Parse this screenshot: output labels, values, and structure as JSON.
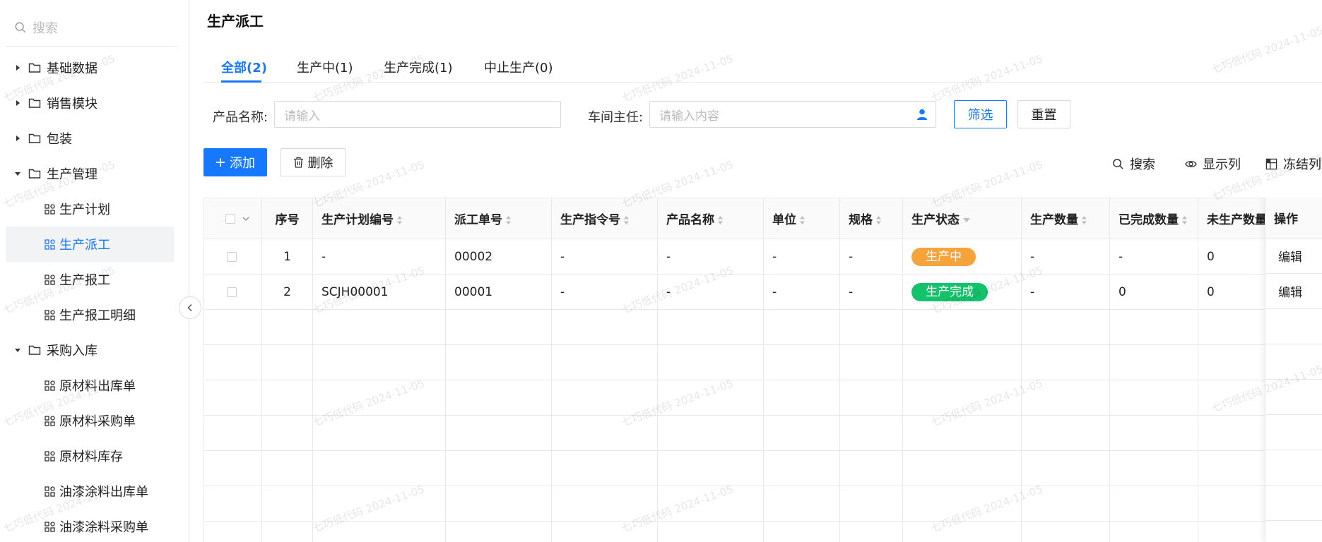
{
  "sidebar": {
    "search_placeholder": "搜索",
    "items": [
      {
        "label": "基础数据",
        "type": "folder",
        "expanded": false
      },
      {
        "label": "销售模块",
        "type": "folder",
        "expanded": false
      },
      {
        "label": "包装",
        "type": "folder",
        "expanded": false
      },
      {
        "label": "生产管理",
        "type": "folder",
        "expanded": true
      },
      {
        "label": "生产计划",
        "type": "page"
      },
      {
        "label": "生产派工",
        "type": "page",
        "active": true
      },
      {
        "label": "生产报工",
        "type": "page"
      },
      {
        "label": "生产报工明细",
        "type": "page"
      },
      {
        "label": "采购入库",
        "type": "folder",
        "expanded": true
      },
      {
        "label": "原材料出库单",
        "type": "page"
      },
      {
        "label": "原材料采购单",
        "type": "page"
      },
      {
        "label": "原材料库存",
        "type": "page"
      },
      {
        "label": "油漆涂料出库单",
        "type": "page"
      },
      {
        "label": "油漆涂料采购单",
        "type": "page"
      }
    ]
  },
  "page": {
    "title": "生产派工",
    "tabs": [
      {
        "label": "全部(2)",
        "active": true
      },
      {
        "label": "生产中(1)"
      },
      {
        "label": "生产完成(1)"
      },
      {
        "label": "中止生产(0)"
      }
    ]
  },
  "filters": {
    "product_label": "产品名称:",
    "product_placeholder": "请输入",
    "director_label": "车间主任:",
    "director_placeholder": "请输入内容",
    "filter_button": "筛选",
    "reset_button": "重置"
  },
  "toolbar": {
    "add_button": "添加",
    "delete_button": "删除",
    "search": "搜索",
    "show_columns": "显示列",
    "freeze_columns": "冻结列"
  },
  "table": {
    "headers": [
      "序号",
      "生产计划编号",
      "派工单号",
      "生产指令号",
      "产品名称",
      "单位",
      "规格",
      "生产状态",
      "生产数量",
      "已完成数量",
      "未生产数量",
      "操作"
    ],
    "rows": [
      {
        "index": "1",
        "plan_no": "-",
        "dispatch_no": "00002",
        "order_no": "-",
        "product": "-",
        "unit": "-",
        "spec": "-",
        "status": "生产中",
        "qty": "-",
        "done": "-",
        "undone": "0",
        "op": "编辑"
      },
      {
        "index": "2",
        "plan_no": "SCJH00001",
        "dispatch_no": "00001",
        "order_no": "-",
        "product": "-",
        "unit": "-",
        "spec": "-",
        "status": "生产完成",
        "qty": "-",
        "done": "0",
        "undone": "0",
        "op": "编辑"
      }
    ]
  },
  "watermark": "七巧低代码 2024-11-05",
  "colors": {
    "primary": "#1677ff",
    "status_in_progress": "#f7a33b",
    "status_done": "#13c26b"
  }
}
